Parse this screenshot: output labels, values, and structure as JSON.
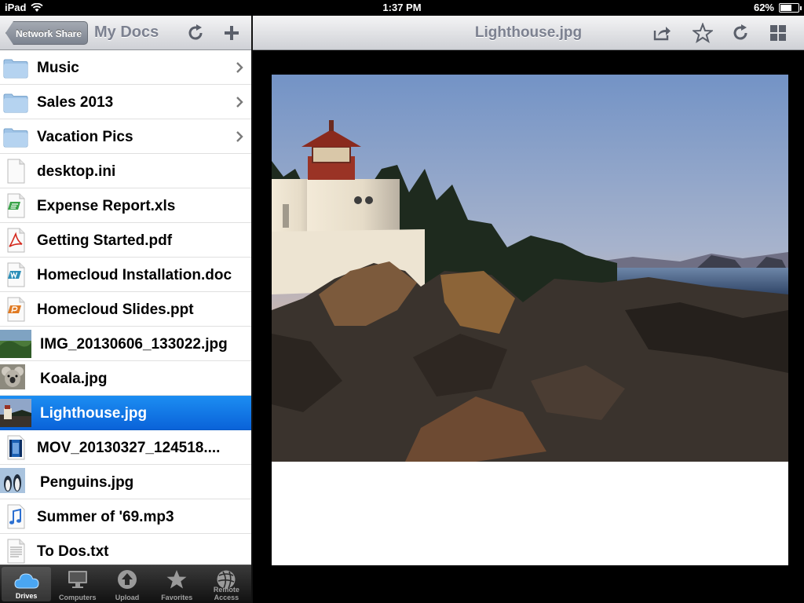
{
  "status": {
    "device": "iPad",
    "time": "1:37 PM",
    "battery": "62%",
    "battery_level": 0.62
  },
  "left_nav": {
    "back_label": "Network Share",
    "title": "My Docs"
  },
  "files": [
    {
      "name": "Music",
      "icon": "folder-icon",
      "kind": "folder"
    },
    {
      "name": "Sales 2013",
      "icon": "folder-icon",
      "kind": "folder"
    },
    {
      "name": "Vacation Pics",
      "icon": "folder-icon",
      "kind": "folder"
    },
    {
      "name": "desktop.ini",
      "icon": "blank-file-icon",
      "kind": "file"
    },
    {
      "name": "Expense Report.xls",
      "icon": "spreadsheet-file-icon",
      "kind": "file"
    },
    {
      "name": "Getting Started.pdf",
      "icon": "pdf-file-icon",
      "kind": "file"
    },
    {
      "name": "Homecloud Installation.doc",
      "icon": "word-file-icon",
      "kind": "file"
    },
    {
      "name": "Homecloud Slides.ppt",
      "icon": "presentation-file-icon",
      "kind": "file"
    },
    {
      "name": "IMG_20130606_133022.jpg",
      "icon": "image-thumbnail-icon",
      "kind": "thumb"
    },
    {
      "name": "Koala.jpg",
      "icon": "koala-thumbnail-icon",
      "kind": "thumb"
    },
    {
      "name": "Lighthouse.jpg",
      "icon": "lighthouse-thumbnail-icon",
      "kind": "thumb",
      "selected": true
    },
    {
      "name": "MOV_20130327_124518....",
      "icon": "video-file-icon",
      "kind": "file"
    },
    {
      "name": "Penguins.jpg",
      "icon": "penguins-thumbnail-icon",
      "kind": "thumb"
    },
    {
      "name": "Summer of '69.mp3",
      "icon": "music-file-icon",
      "kind": "file"
    },
    {
      "name": "To Dos.txt",
      "icon": "text-file-icon",
      "kind": "file"
    }
  ],
  "tabs": [
    {
      "label": "Drives",
      "icon": "cloud-icon",
      "active": true
    },
    {
      "label": "Computers",
      "icon": "monitor-icon",
      "active": false
    },
    {
      "label": "Upload",
      "icon": "upload-icon",
      "active": false
    },
    {
      "label": "Favorites",
      "icon": "star-icon",
      "active": false
    },
    {
      "label": "Remote Access",
      "icon": "globe-icon",
      "active": false
    }
  ],
  "right_nav": {
    "title": "Lighthouse.jpg"
  },
  "colors": {
    "selection": "#0a63d9",
    "nav_title": "#7c8190"
  }
}
